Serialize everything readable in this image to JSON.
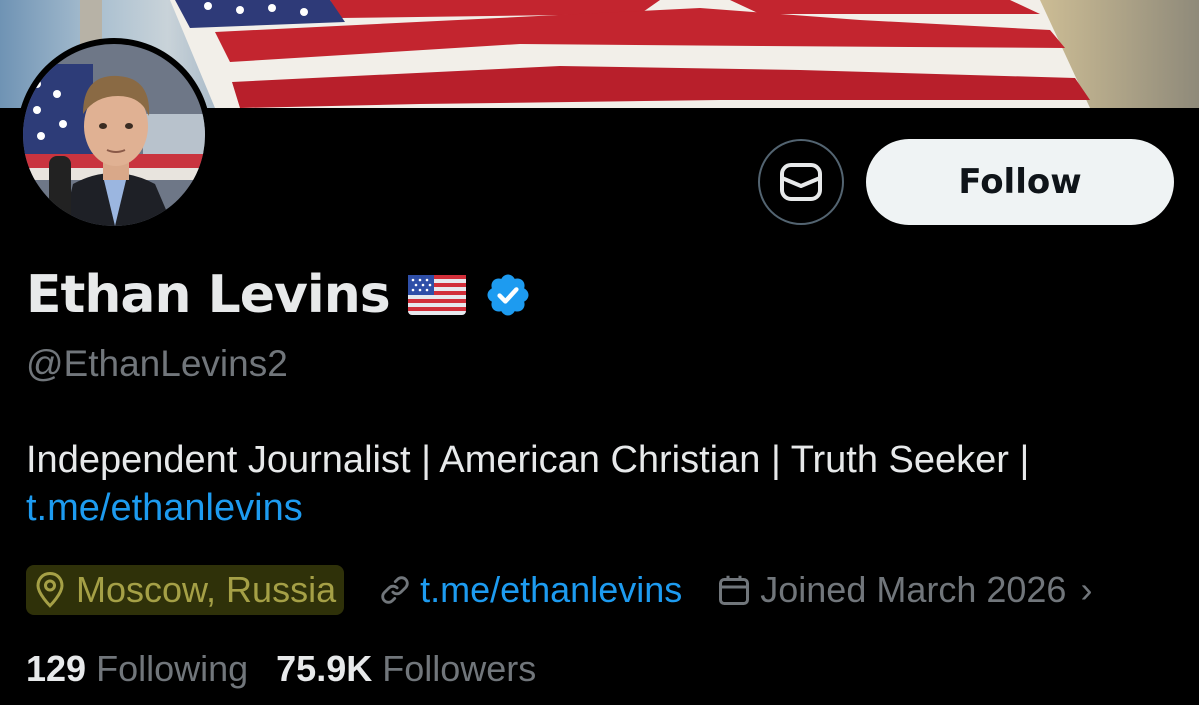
{
  "profile": {
    "display_name": "Ethan Levins",
    "handle": "@EthanLevins2",
    "name_emoji": "us-flag-emoji",
    "verified_icon": "verified-badge-icon",
    "bio_text": "Independent Journalist | American Christian | Truth Seeker |",
    "bio_link": "t.me/ethanlevins"
  },
  "actions": {
    "message_icon": "envelope-icon",
    "follow_label": "Follow"
  },
  "meta": {
    "location": "Moscow, Russia",
    "website": "t.me/ethanlevins",
    "joined": "Joined March 2026",
    "more_glyph": "›"
  },
  "stats": {
    "following_count": "129",
    "following_label": "Following",
    "followers_count": "75.9K",
    "followers_label": "Followers"
  },
  "colors": {
    "background": "#000000",
    "primary_text": "#e7e9ea",
    "secondary_text": "#71767b",
    "link": "#1d9bf0",
    "verified": "#1d9bf0",
    "location_highlight": "#2f3109"
  }
}
